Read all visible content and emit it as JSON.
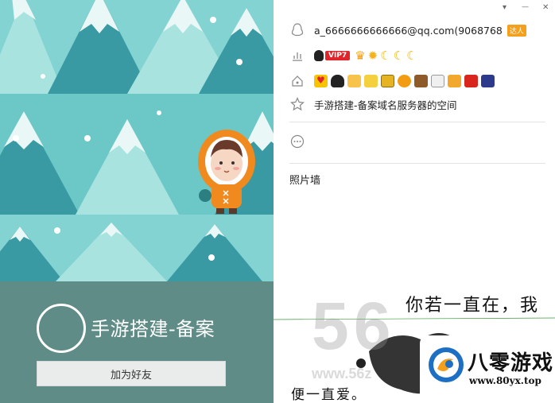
{
  "window": {
    "pin_glyph": "▾",
    "minimize_glyph": "—",
    "close_glyph": "✕"
  },
  "profile": {
    "nickname": "手游搭建-备案",
    "add_friend_label": "加为好友",
    "account_text": "a_6666666666666@qq.com(9068768",
    "level_badge_text": "VIP7",
    "expert_badge_text": "达人",
    "signature": "手游搭建-备案域名服务器的空间",
    "photo_wall_label": "照片墙"
  },
  "icons": {
    "account": "qq-penguin-outline-icon",
    "level": "level-chart-icon",
    "services": "house-icon",
    "signature": "star-outline-icon",
    "more": "ellipsis-circle-icon",
    "level_row": [
      "vip-penguin-icon",
      "crown-icon",
      "sun-icon",
      "moon-icon",
      "moon-icon",
      "moon-icon"
    ],
    "service_row": [
      "heart-icon",
      "penguin-icon",
      "hand-icon",
      "music-icon",
      "card-icon",
      "coin-icon",
      "tag-icon",
      "diamond-icon",
      "game-icon",
      "color-icon",
      "show-icon"
    ]
  },
  "photo": {
    "line1": "你若一直在，我",
    "line2": "便一直爱。",
    "watermark": "56",
    "watermark_sub": "www.56z",
    "site_name": "八零游戏",
    "site_url": "www.80yx.top"
  },
  "colors": {
    "card_bg": "#5f8c86",
    "sky": "#84d3d3",
    "tree_dark": "#3a9aa3",
    "tree_light": "#a9e3e0",
    "vip_red": "#e0262b",
    "logo_blue": "#1c6fc2",
    "logo_orange": "#f5a01a"
  }
}
